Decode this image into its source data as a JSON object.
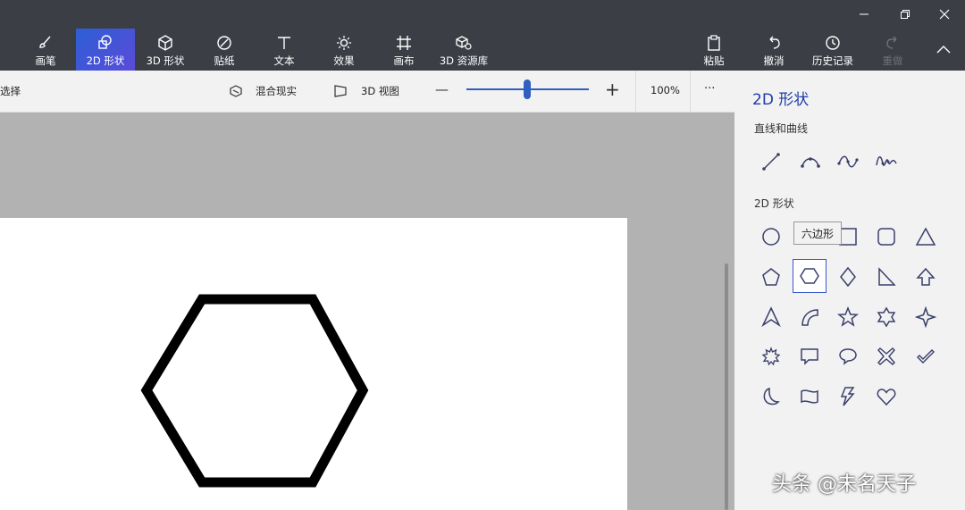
{
  "window_controls": {
    "minimize": "minimize-icon",
    "restore": "restore-icon",
    "close": "close-icon"
  },
  "ribbon": {
    "tabs": [
      {
        "label": "画笔",
        "icon": "brush-icon"
      },
      {
        "label": "2D 形状",
        "icon": "2d-shapes-icon",
        "active": true
      },
      {
        "label": "3D 形状",
        "icon": "3d-cube-icon"
      },
      {
        "label": "贴纸",
        "icon": "sticker-icon"
      },
      {
        "label": "文本",
        "icon": "text-icon"
      },
      {
        "label": "效果",
        "icon": "effects-icon"
      },
      {
        "label": "画布",
        "icon": "canvas-icon"
      },
      {
        "label": "3D 资源库",
        "icon": "3d-library-icon"
      }
    ],
    "right_tabs": [
      {
        "label": "粘贴",
        "icon": "paste-icon"
      },
      {
        "label": "撤消",
        "icon": "undo-icon"
      },
      {
        "label": "历史记录",
        "icon": "history-icon"
      },
      {
        "label": "重做",
        "icon": "redo-icon",
        "disabled": true
      }
    ],
    "collapse_icon": "chevron-up-icon"
  },
  "toolbar": {
    "select_label": "选择",
    "mixed_reality_label": "混合现实",
    "view3d_label": "3D 视图",
    "zoom_minus": "—",
    "zoom_plus": "+",
    "zoom_value": "100%",
    "zoom_slider_fraction": 0.5,
    "more_label": "···"
  },
  "panel": {
    "title": "2D 形状",
    "lines_section": "直线和曲线",
    "shapes_section": "2D 形状",
    "lines": [
      "line-icon",
      "curve-icon",
      "wave-curve-icon",
      "multi-curve-icon"
    ],
    "shapes": [
      "circle-icon",
      "hexagon-icon",
      "square-icon",
      "rounded-square-icon",
      "triangle-icon",
      "pentagon-icon",
      "hexagon-selected-icon",
      "diamond-icon",
      "right-triangle-icon",
      "arrow-up-icon",
      "arrowhead-icon",
      "quarter-circle-icon",
      "star-5-icon",
      "star-6-icon",
      "star-4-icon",
      "burst-icon",
      "speech-bubble-rect-icon",
      "speech-bubble-oval-icon",
      "x-icon",
      "checkmark-icon",
      "crescent-icon",
      "banner-icon",
      "lightning-icon",
      "heart-icon"
    ],
    "tooltip": "六边形"
  },
  "canvas": {
    "shape": "hexagon"
  },
  "watermark": "头条 @未名天子",
  "colors": {
    "ribbon": "#3b3f45",
    "accent": "#2d5fd6",
    "panel": "#f2f2f2",
    "canvas_bg": "#b2b2b2"
  }
}
